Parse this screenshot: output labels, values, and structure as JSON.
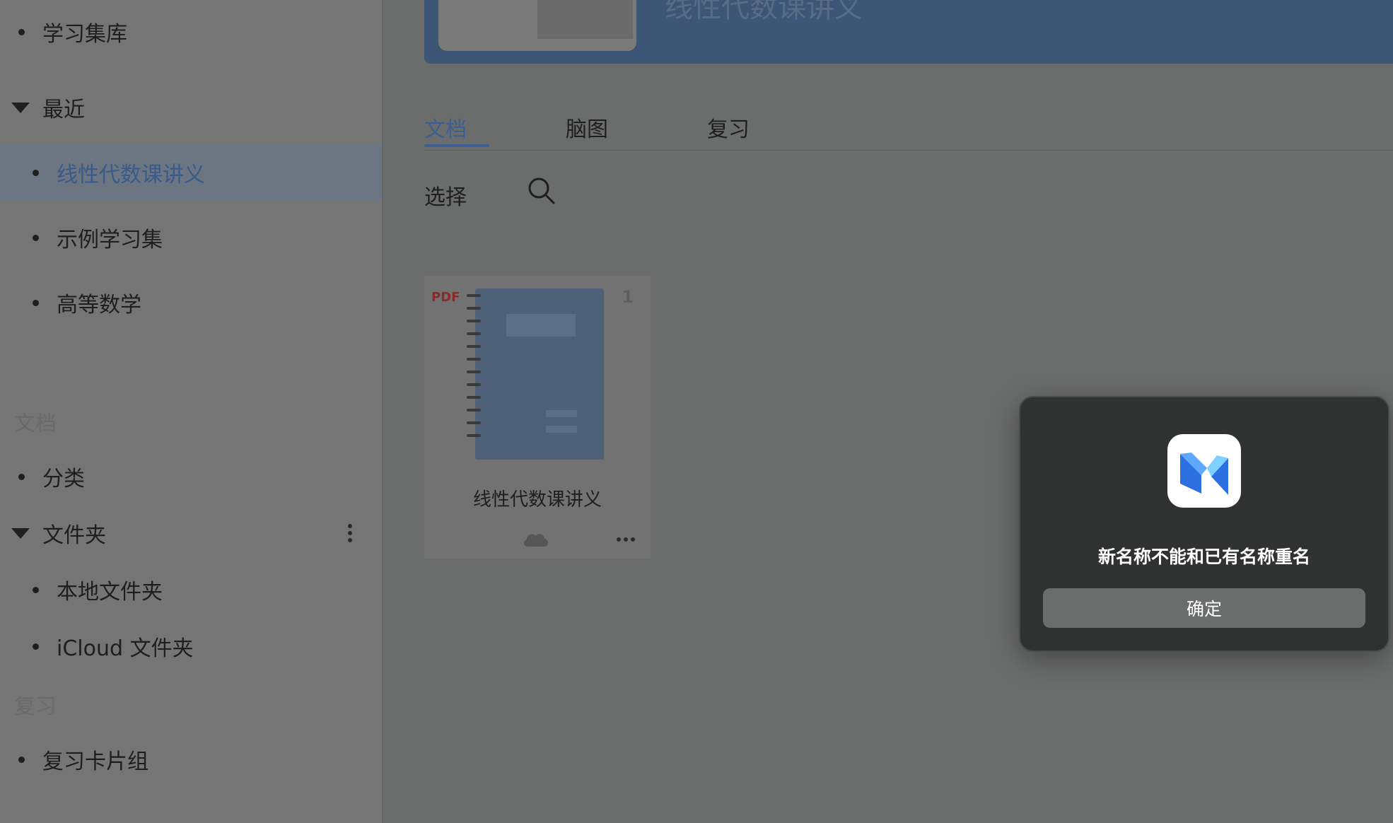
{
  "sidebar": {
    "library": "学习集库",
    "recent_header": "最近",
    "recent_items": [
      "线性代数课讲义",
      "示例学习集",
      "高等数学"
    ],
    "docs_section": "文档",
    "category": "分类",
    "folder_header": "文件夹",
    "folder_items": [
      "本地文件夹",
      "iCloud 文件夹"
    ],
    "review_section": "复习",
    "review_cards": "复习卡片组"
  },
  "header": {
    "title": "线性代数课讲义"
  },
  "tabs": [
    "文档",
    "脑图",
    "复习"
  ],
  "toolbar": {
    "select": "选择",
    "search_icon": "search-icon"
  },
  "document_card": {
    "type_badge": "PDF",
    "page_count": "1",
    "title": "线性代数课讲义"
  },
  "dialog": {
    "message": "新名称不能和已有名称重名",
    "confirm": "确定"
  },
  "colors": {
    "accent": "#3b5e93",
    "dialog_bg": "#303232",
    "pdf_badge": "#8a2a2a"
  }
}
